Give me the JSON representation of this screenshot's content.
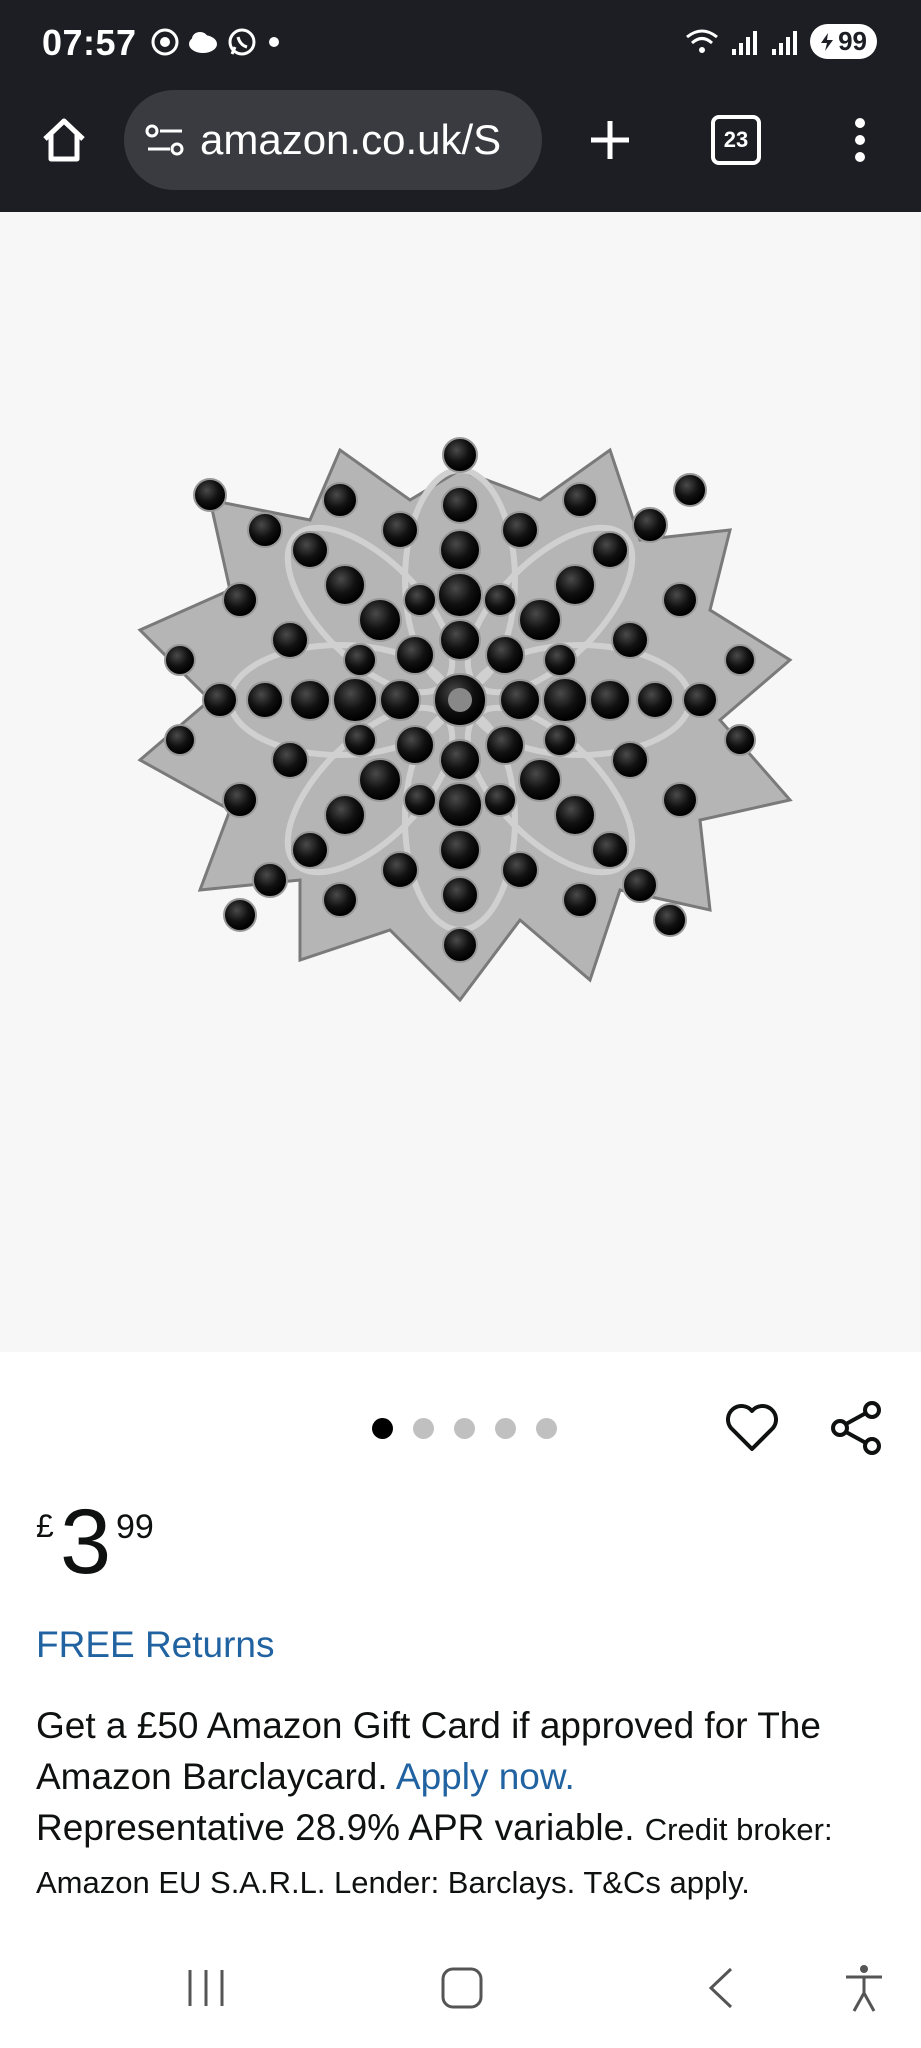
{
  "status_bar": {
    "time": "07:57",
    "battery": "99",
    "icons": [
      "chrome-icon",
      "cloud-icon",
      "whatsapp-icon",
      "dot-icon",
      "wifi-icon",
      "signal-icon",
      "signal-icon",
      "battery-icon"
    ]
  },
  "browser": {
    "url": "amazon.co.uk/S",
    "tab_count": "23",
    "icons": [
      "home-icon",
      "site-settings-icon",
      "new-tab-icon",
      "tab-switcher-icon",
      "menu-icon"
    ]
  },
  "product": {
    "image_alt": "black crystal flower brooch",
    "carousel": {
      "total": 5,
      "active": 1
    },
    "price": {
      "currency": "£",
      "whole": "3",
      "fraction": "99"
    },
    "free_returns": "FREE Returns",
    "promo": {
      "line1": "Get a £50 Amazon Gift Card if approved for The Amazon Barclaycard. ",
      "apply_link": "Apply now.",
      "line2": "Representative 28.9% APR variable. ",
      "small": "Credit broker: Amazon EU S.A.R.L. Lender: Barclays. T&Cs apply."
    }
  },
  "nav_bar": {
    "icons": [
      "recent-apps-icon",
      "home-button-icon",
      "back-icon",
      "accessibility-icon"
    ]
  },
  "colors": {
    "status_bg": "#1d1e23",
    "url_pill": "#3a3b40",
    "link": "#2162a1",
    "text": "#0f1111",
    "image_bg": "#f7f7f7"
  }
}
